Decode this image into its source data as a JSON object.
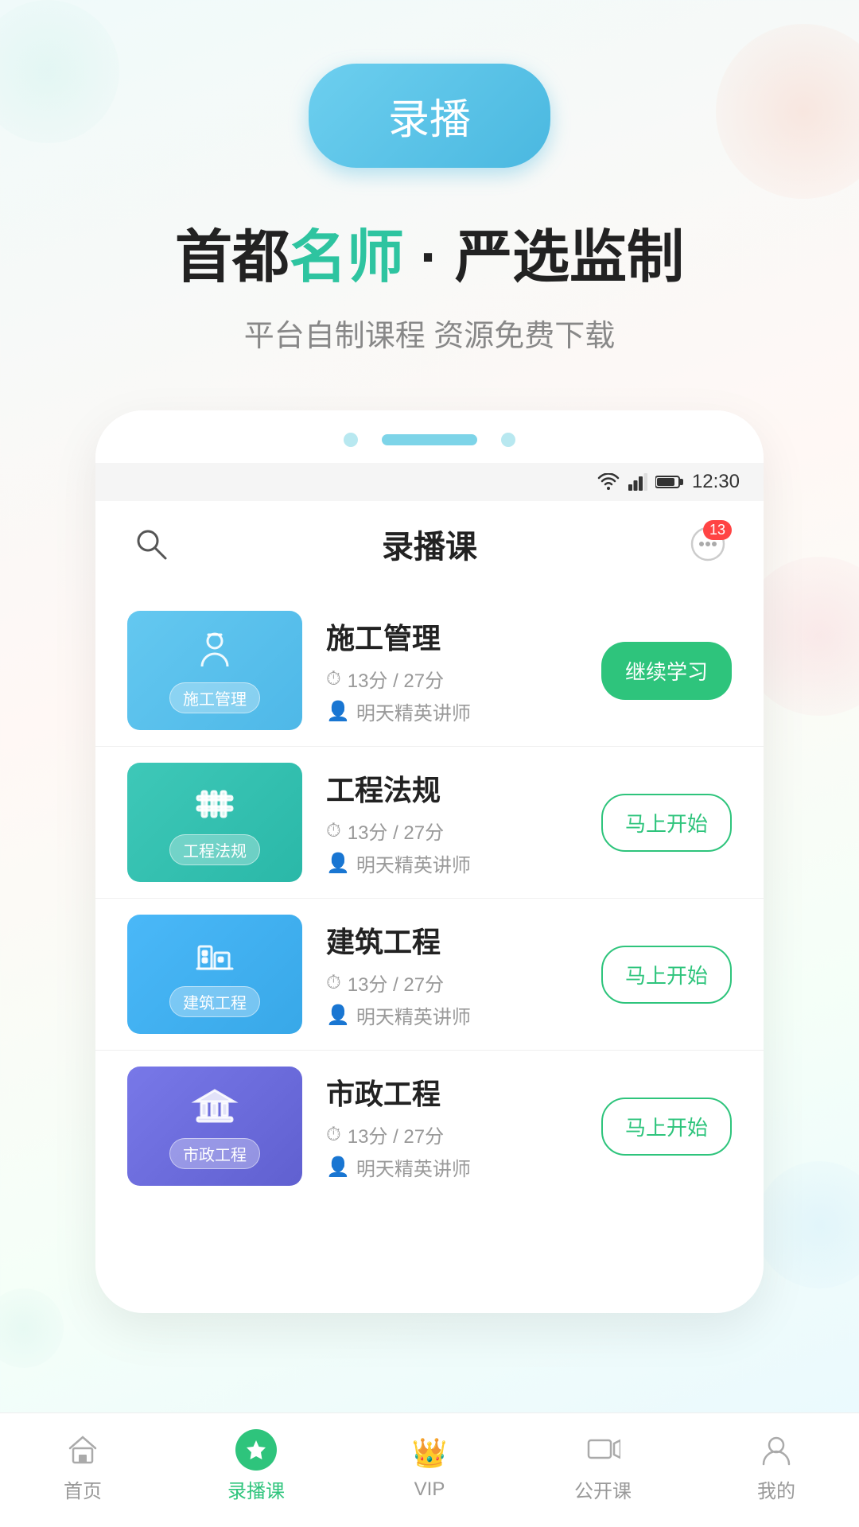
{
  "header": {
    "record_btn_label": "录播",
    "headline_part1": "首都",
    "headline_accent": "名师",
    "headline_part2": " · 严选监制",
    "subheadline": "平台自制课程 资源免费下载"
  },
  "phone": {
    "status_time": "12:30",
    "app_title": "录播课",
    "notification_count": "13"
  },
  "courses": [
    {
      "id": 1,
      "name": "施工管理",
      "thumb_label": "施工管理",
      "thumb_color": "blue1",
      "icon_type": "worker",
      "duration": "13分",
      "total": "27分",
      "teacher": "明天精英讲师",
      "action": "continue",
      "action_label": "继续学习"
    },
    {
      "id": 2,
      "name": "工程法规",
      "thumb_label": "工程法规",
      "thumb_color": "teal1",
      "icon_type": "fence",
      "duration": "13分",
      "total": "27分",
      "teacher": "明天精英讲师",
      "action": "start",
      "action_label": "马上开始"
    },
    {
      "id": 3,
      "name": "建筑工程",
      "thumb_label": "建筑工程",
      "thumb_color": "blue2",
      "icon_type": "building",
      "duration": "13分",
      "total": "27分",
      "teacher": "明天精英讲师",
      "action": "start",
      "action_label": "马上开始"
    },
    {
      "id": 4,
      "name": "市政工程",
      "thumb_label": "市政工程",
      "thumb_color": "purple1",
      "icon_type": "bank",
      "duration": "13分",
      "total": "27分",
      "teacher": "明天精英讲师",
      "action": "start",
      "action_label": "马上开始"
    }
  ],
  "bottom_nav": [
    {
      "id": "home",
      "label": "首页",
      "active": false
    },
    {
      "id": "record",
      "label": "录播课",
      "active": true
    },
    {
      "id": "vip",
      "label": "VIP",
      "active": false
    },
    {
      "id": "live",
      "label": "公开课",
      "active": false
    },
    {
      "id": "profile",
      "label": "我的",
      "active": false
    }
  ]
}
